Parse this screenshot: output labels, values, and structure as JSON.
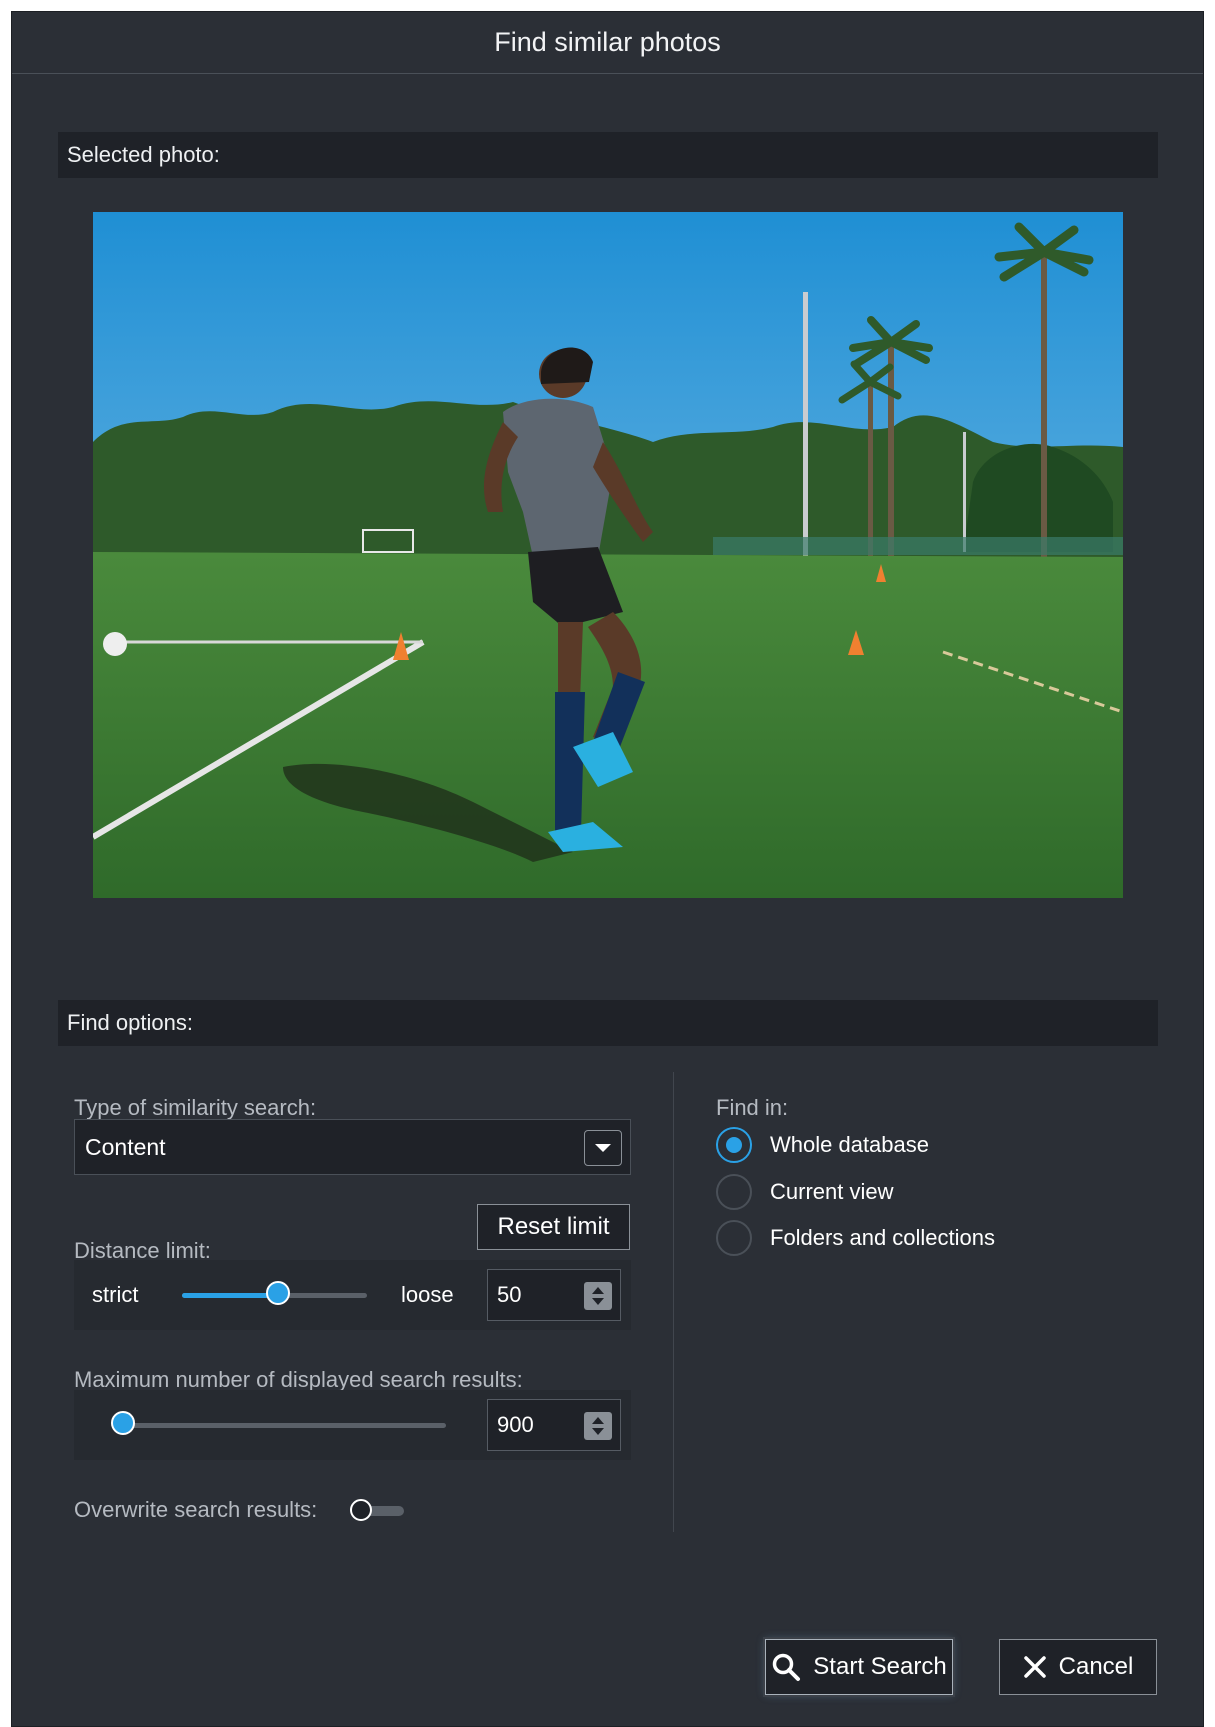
{
  "dialog": {
    "title": "Find similar photos"
  },
  "selected_photo": {
    "header": "Selected photo:"
  },
  "find_options": {
    "header": "Find options:",
    "similarity_type": {
      "label": "Type of similarity search:",
      "value": "Content"
    },
    "distance_limit": {
      "label": "Distance limit:",
      "reset_label": "Reset limit",
      "left_word": "strict",
      "right_word": "loose",
      "value": "50",
      "slider_fraction": 0.52
    },
    "max_results": {
      "label": "Maximum number of displayed search results:",
      "value": "900",
      "slider_fraction": 0.02
    },
    "overwrite": {
      "label": "Overwrite search results:",
      "enabled": false
    },
    "find_in": {
      "label": "Find in:",
      "options": [
        {
          "label": "Whole database",
          "selected": true
        },
        {
          "label": "Current view",
          "selected": false
        },
        {
          "label": "Folders and collections",
          "selected": false
        }
      ]
    }
  },
  "actions": {
    "start_search": "Start Search",
    "cancel": "Cancel"
  },
  "colors": {
    "accent": "#2aa1e6",
    "dialog_bg": "#2b2f36",
    "panel_bg": "#1f2228"
  },
  "icons": {
    "search": "magnifier-icon",
    "cancel": "close-icon",
    "dropdown": "chevron-down-icon"
  }
}
